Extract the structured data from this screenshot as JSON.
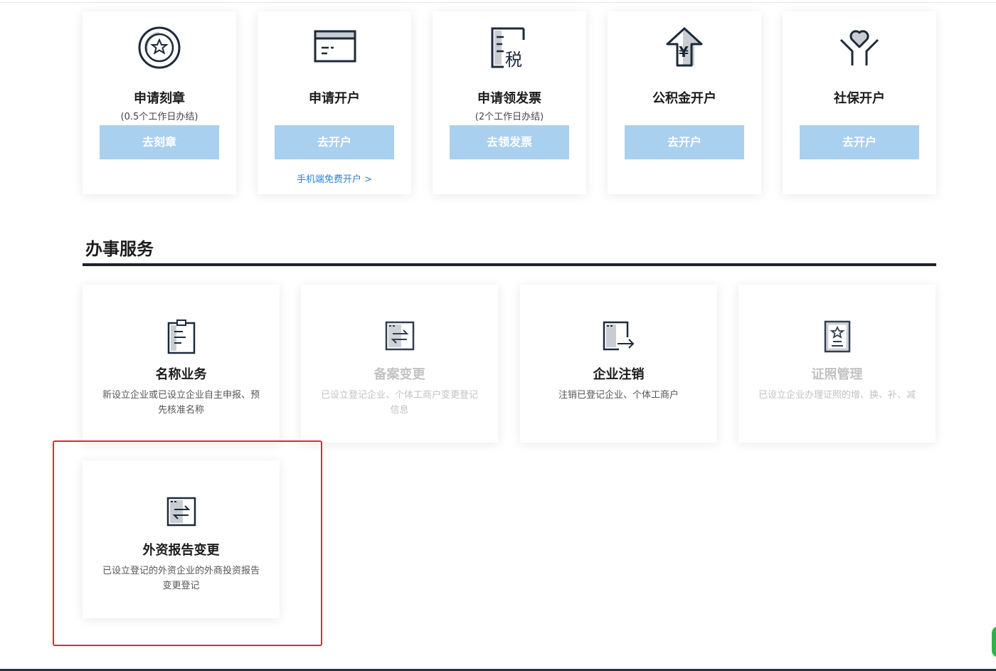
{
  "top_services": [
    {
      "title": "申请刻章",
      "subtitle": "(0.5个工作日办结)",
      "button": "去刻章",
      "link": "",
      "icon": "seal-icon"
    },
    {
      "title": "申请开户",
      "subtitle": "",
      "button": "去开户",
      "link": "手机端免费开户 >",
      "icon": "bank-card-icon"
    },
    {
      "title": "申请领发票",
      "subtitle": "(2个工作日办结)",
      "button": "去领发票",
      "link": "",
      "icon": "tax-invoice-icon"
    },
    {
      "title": "公积金开户",
      "subtitle": "",
      "button": "去开户",
      "link": "",
      "icon": "housing-fund-icon"
    },
    {
      "title": "社保开户",
      "subtitle": "",
      "button": "去开户",
      "link": "",
      "icon": "social-security-icon"
    }
  ],
  "section": {
    "title": "办事服务"
  },
  "services": [
    {
      "title": "名称业务",
      "desc": "新设立企业或已设立企业自主申报、预先核准名称",
      "enabled": true,
      "icon": "clipboard-icon"
    },
    {
      "title": "备案变更",
      "desc": "已设立登记企业、个体工商户变更登记信息",
      "enabled": false,
      "icon": "exchange-doc-icon"
    },
    {
      "title": "企业注销",
      "desc": "注销已登记企业、个体工商户",
      "enabled": true,
      "icon": "exit-doc-icon"
    },
    {
      "title": "证照管理",
      "desc": "已设立企业办理证照的增、换、补、减",
      "enabled": false,
      "icon": "certificate-icon"
    },
    {
      "title": "外资报告变更",
      "desc": "已设立登记的外资企业的外商投资报告变更登记",
      "enabled": true,
      "icon": "exchange-doc-icon"
    }
  ],
  "colors": {
    "button_bg": "#a9d0ef",
    "link": "#2f7fd3",
    "highlight": "#e02a2a",
    "text_dark": "#1c1c1c"
  }
}
